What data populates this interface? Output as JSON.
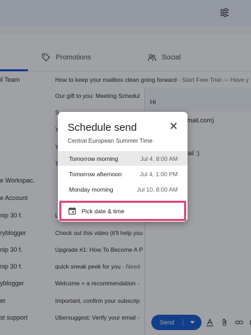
{
  "tabs": {
    "promotions": "Promotions",
    "social": "Social"
  },
  "senders": [
    "il Team",
    "e Workspac.",
    "e Account",
    "nip 30 f.",
    "ryblogger",
    "nip 30 f.",
    "nip 30 f.",
    "yblogger",
    "er",
    "st support"
  ],
  "emails": [
    {
      "subject": "How to keep your mailbox clean going forward",
      "snippet": " - Start Free Trial — Have y"
    },
    {
      "subject": "Our gift to you: Meeting Schedul",
      "snippet": ""
    },
    {
      "subject": "S",
      "snippet": ""
    },
    {
      "subject": "Y",
      "snippet": ""
    },
    {
      "subject": "Y",
      "snippet": ""
    },
    {
      "subject": "T",
      "snippet": ""
    },
    {
      "subject": "L",
      "snippet": ""
    },
    {
      "subject": "Check out this video (it'll help you",
      "snippet": ""
    },
    {
      "subject": "Upgrade #1: How To Become A P",
      "snippet": ""
    },
    {
      "subject": "quick sneak peek for you",
      "snippet": " - Need"
    },
    {
      "subject": "Welcome + a recommendation",
      "snippet": " -"
    },
    {
      "subject": "Important, confirm your subscrip",
      "snippet": ""
    },
    {
      "subject": "Ubersuggest: Verify your email",
      "snippet": " -"
    }
  ],
  "compose": {
    "greeting": "Hi",
    "email_fragment": "mail.com)",
    "smile": "ail :)",
    "send_label": "Send"
  },
  "dialog": {
    "title": "Schedule send",
    "subtitle": "Central European Summer Time",
    "options": [
      {
        "label": "Tomorrow morning",
        "time": "Jul 4, 8:00 AM",
        "selected": true
      },
      {
        "label": "Tomorrow afternoon",
        "time": "Jul 4, 1:00 PM",
        "selected": false
      },
      {
        "label": "Monday morning",
        "time": "Jul 10, 8:00 AM",
        "selected": false
      }
    ],
    "pick_label": "Pick date & time"
  },
  "colors": {
    "accent": "#0b57d0",
    "highlight": "#e0487a",
    "overlay": "rgba(28,32,40,0.42)"
  },
  "icons": [
    "filter-icon",
    "tag-icon",
    "people-icon",
    "close-icon",
    "calendar-icon",
    "chevron-down-icon",
    "text-format-icon",
    "attach-icon",
    "link-icon",
    "emoji-icon"
  ]
}
